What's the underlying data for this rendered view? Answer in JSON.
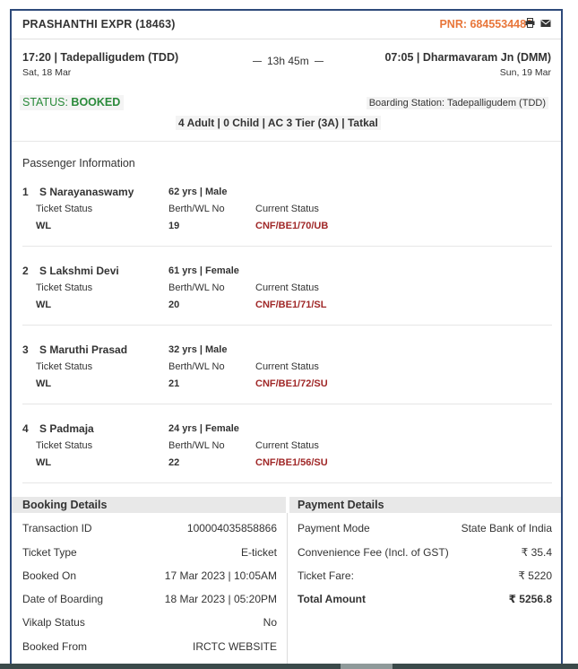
{
  "train": {
    "name": "PRASHANTHI EXPR (18463)",
    "pnr": "PNR: 6845534486",
    "departure": "17:20 | Tadepalligudem (TDD)",
    "departure_date": "Sat, 18 Mar",
    "duration": "13h 45m",
    "arrival": "07:05 | Dharmavaram Jn (DMM)",
    "arrival_date": "Sun, 19 Mar",
    "status_label": "STATUS:",
    "status_value": "BOOKED",
    "boarding_station": "Boarding Station: Tadepalligudem (TDD)",
    "summary": "4 Adult | 0 Child | AC 3 Tier (3A) | Tatkal"
  },
  "icons": [
    "print-icon",
    "email-icon"
  ],
  "passengers_heading": "Passenger Information",
  "labels": {
    "ticket_status": "Ticket Status",
    "berth": "Berth/WL No",
    "current_status": "Current Status"
  },
  "passengers": [
    {
      "num": "1",
      "name": "S Narayanaswamy",
      "age": "62 yrs | Male",
      "ticket_status": "WL",
      "berth": "19",
      "current_status": "CNF/BE1/70/UB"
    },
    {
      "num": "2",
      "name": "S Lakshmi Devi",
      "age": "61 yrs | Female",
      "ticket_status": "WL",
      "berth": "20",
      "current_status": "CNF/BE1/71/SL"
    },
    {
      "num": "3",
      "name": "S Maruthi Prasad",
      "age": "32 yrs | Male",
      "ticket_status": "WL",
      "berth": "21",
      "current_status": "CNF/BE1/72/SU"
    },
    {
      "num": "4",
      "name": "S Padmaja",
      "age": "24 yrs | Female",
      "ticket_status": "WL",
      "berth": "22",
      "current_status": "CNF/BE1/56/SU"
    }
  ],
  "booking": {
    "heading": "Booking Details",
    "rows": [
      {
        "label": "Transaction ID",
        "value": "100004035858866"
      },
      {
        "label": "Ticket Type",
        "value": "E-ticket"
      },
      {
        "label": "Booked On",
        "value": "17 Mar 2023 | 10:05AM"
      },
      {
        "label": "Date of Boarding",
        "value": "18 Mar 2023 | 05:20PM"
      },
      {
        "label": "Vikalp Status",
        "value": "No"
      },
      {
        "label": "Booked From",
        "value": "IRCTC WEBSITE"
      }
    ]
  },
  "payment": {
    "heading": "Payment Details",
    "rows": [
      {
        "label": "Payment Mode",
        "value": "State Bank of India"
      },
      {
        "label": "Convenience Fee (Incl. of GST)",
        "value": "₹ 35.4"
      },
      {
        "label": "Ticket Fare:",
        "value": "₹ 5220"
      },
      {
        "label": "Total Amount",
        "value": "₹ 5256.8"
      }
    ]
  }
}
